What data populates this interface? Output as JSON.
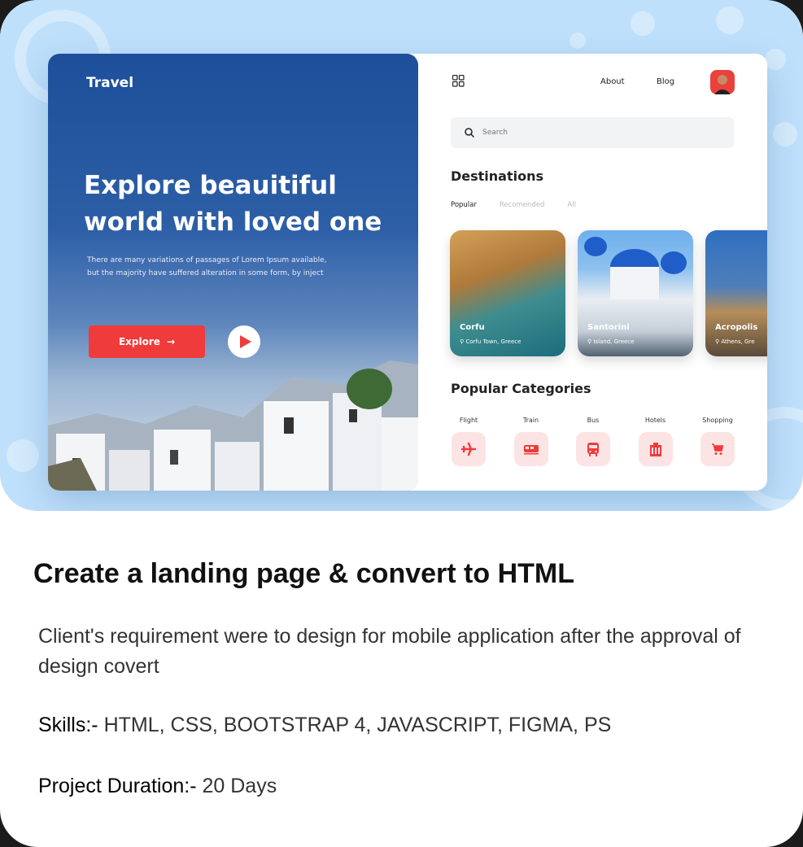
{
  "mockup": {
    "brand": "Travel",
    "hero_title": "Explore beauitiful world with loved one",
    "hero_desc": "There are many variations of passages of Lorem Ipsum available, but the majority have suffered alteration in some form, by inject",
    "explore_label": "Explore",
    "nav_about": "About",
    "nav_blog": "Blog",
    "search_placeholder": "Search",
    "destinations_title": "Destinations",
    "tabs": [
      "Popular",
      "Recomended",
      "All"
    ],
    "destinations": [
      {
        "name": "Corfu",
        "location": "Corfu Town, Greece"
      },
      {
        "name": "Santorini",
        "location": "Island, Greece"
      },
      {
        "name": "Acropolis",
        "location": "Athens, Gre"
      }
    ],
    "categories_title": "Popular Categories",
    "categories": [
      {
        "label": "Flight",
        "icon": "plane-icon"
      },
      {
        "label": "Train",
        "icon": "train-icon"
      },
      {
        "label": "Bus",
        "icon": "bus-icon"
      },
      {
        "label": "Hotels",
        "icon": "hotel-icon"
      },
      {
        "label": "Shopping",
        "icon": "cart-icon"
      }
    ],
    "accent_color": "#ef3b3b",
    "hero_blue": "#1d4f9a"
  },
  "project": {
    "title": "Create a landing page & convert to HTML",
    "description": "Client's requirement were to design for mobile application after the approval of design covert",
    "skills_label": "Skills:-",
    "skills": "HTML, CSS, BOOTSTRAP 4, JAVASCRIPT, FIGMA, PS",
    "duration_label": "Project Duration:-",
    "duration": "20 Days"
  }
}
